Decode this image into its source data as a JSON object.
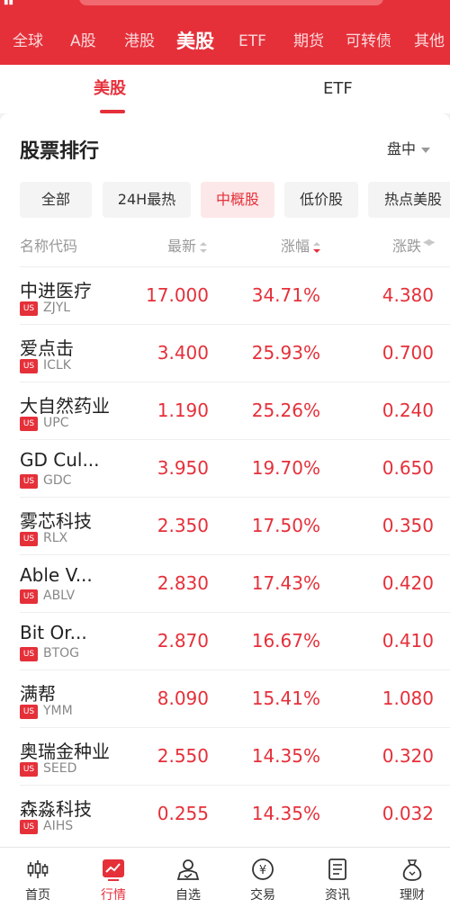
{
  "market_tabs": [
    "全球",
    "A股",
    "港股",
    "美股",
    "ETF",
    "期货",
    "可转债",
    "其他"
  ],
  "sub_tabs": [
    "美股",
    "ETF"
  ],
  "section": {
    "title": "股票排行",
    "session": "盘中"
  },
  "filters": [
    "全部",
    "24H最热",
    "中概股",
    "低价股",
    "热点美股"
  ],
  "columns": {
    "name": "名称代码",
    "latest": "最新",
    "pct": "涨幅",
    "change": "涨跌"
  },
  "stocks": [
    {
      "name": "中进医疗",
      "market": "US",
      "code": "ZJYL",
      "price": "17.000",
      "pct": "34.71%",
      "change": "4.380"
    },
    {
      "name": "爱点击",
      "market": "US",
      "code": "ICLK",
      "price": "3.400",
      "pct": "25.93%",
      "change": "0.700"
    },
    {
      "name": "大自然药业",
      "market": "US",
      "code": "UPC",
      "price": "1.190",
      "pct": "25.26%",
      "change": "0.240"
    },
    {
      "name": "GD Cul...",
      "market": "US",
      "code": "GDC",
      "price": "3.950",
      "pct": "19.70%",
      "change": "0.650"
    },
    {
      "name": "雾芯科技",
      "market": "US",
      "code": "RLX",
      "price": "2.350",
      "pct": "17.50%",
      "change": "0.350"
    },
    {
      "name": "Able V...",
      "market": "US",
      "code": "ABLV",
      "price": "2.830",
      "pct": "17.43%",
      "change": "0.420"
    },
    {
      "name": "Bit Or...",
      "market": "US",
      "code": "BTOG",
      "price": "2.870",
      "pct": "16.67%",
      "change": "0.410"
    },
    {
      "name": "满帮",
      "market": "US",
      "code": "YMM",
      "price": "8.090",
      "pct": "15.41%",
      "change": "1.080"
    },
    {
      "name": "奥瑞金种业",
      "market": "US",
      "code": "SEED",
      "price": "2.550",
      "pct": "14.35%",
      "change": "0.320"
    },
    {
      "name": "森淼科技",
      "market": "US",
      "code": "AIHS",
      "price": "0.255",
      "pct": "14.35%",
      "change": "0.032"
    }
  ],
  "bottom_nav": [
    {
      "label": "首页",
      "icon": "home-candlestick-icon"
    },
    {
      "label": "行情",
      "icon": "market-chart-icon"
    },
    {
      "label": "自选",
      "icon": "watchlist-person-icon"
    },
    {
      "label": "交易",
      "icon": "trade-yen-icon"
    },
    {
      "label": "资讯",
      "icon": "news-document-icon"
    },
    {
      "label": "理财",
      "icon": "wealth-bag-icon"
    }
  ],
  "colors": {
    "accent": "#e5303a",
    "up": "#e5303a",
    "muted": "#999999"
  }
}
